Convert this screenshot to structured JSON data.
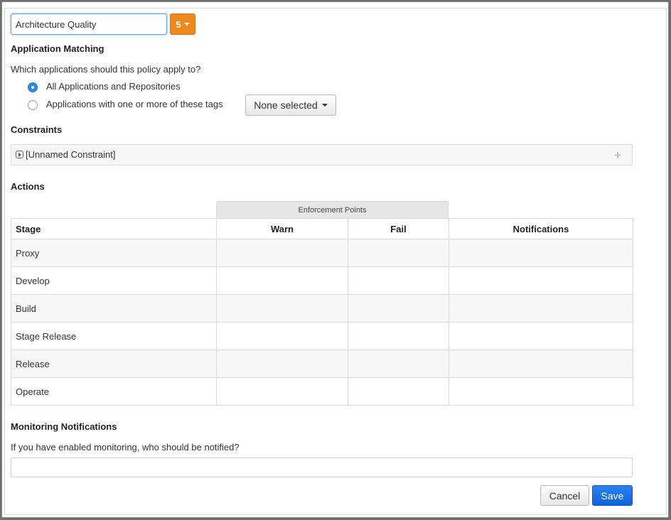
{
  "policy": {
    "name_value": "Architecture Quality",
    "threat_level": "5"
  },
  "application_matching": {
    "title": "Application Matching",
    "question": "Which applications should this policy apply to?",
    "options": [
      {
        "label": "All Applications and Repositories",
        "selected": true
      },
      {
        "label": "Applications with one or more of these tags",
        "selected": false
      }
    ],
    "tags_dropdown_label": "None selected"
  },
  "constraints": {
    "title": "Constraints",
    "items": [
      {
        "label": "[Unnamed Constraint]"
      }
    ],
    "add_icon": "plus-icon"
  },
  "actions": {
    "title": "Actions",
    "group_header": "Enforcement Points",
    "columns": [
      "Stage",
      "Warn",
      "Fail",
      "Notifications"
    ],
    "rows": [
      {
        "stage": "Proxy"
      },
      {
        "stage": "Develop"
      },
      {
        "stage": "Build"
      },
      {
        "stage": "Stage Release"
      },
      {
        "stage": "Release"
      },
      {
        "stage": "Operate"
      }
    ]
  },
  "monitoring": {
    "title": "Monitoring Notifications",
    "question": "If you have enabled monitoring, who should be notified?",
    "value": ""
  },
  "buttons": {
    "cancel": "Cancel",
    "save": "Save"
  },
  "colors": {
    "threat_orange": "#f0891d",
    "primary_blue": "#1a6fe0",
    "radio_selected": "#2f87e8"
  }
}
